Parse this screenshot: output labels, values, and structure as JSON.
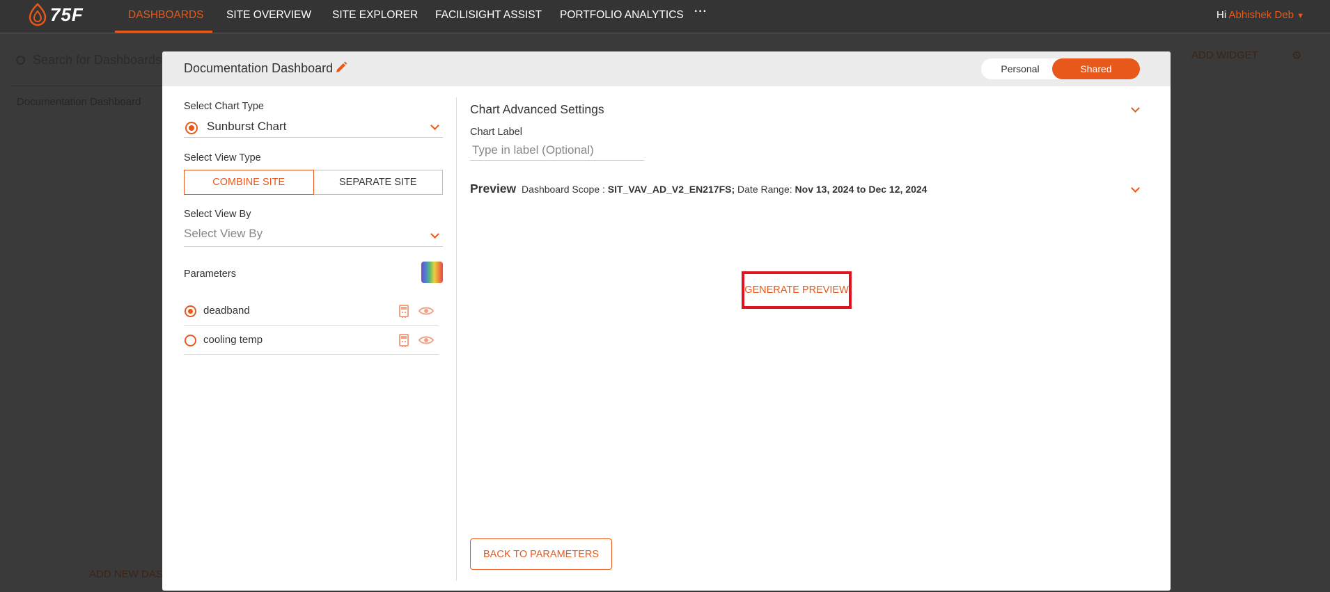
{
  "brand": {
    "logo_text": "75F",
    "accent_color": "#e8581a",
    "highlight_color": "#e0141e"
  },
  "nav": {
    "items": [
      {
        "label": "DASHBOARDS",
        "active": true
      },
      {
        "label": "SITE OVERVIEW",
        "active": false
      },
      {
        "label": "SITE EXPLORER",
        "active": false
      },
      {
        "label": "FACILISIGHT ASSIST",
        "active": false
      },
      {
        "label": "PORTFOLIO ANALYTICS",
        "active": false
      }
    ],
    "more_label": "···",
    "greeting": "Hi",
    "user_name": "Abhishek Deb"
  },
  "background": {
    "search_placeholder": "Search for Dashboards",
    "dashboard_list_item": "Documentation Dashboard",
    "add_widget_label": "ADD WIDGET",
    "add_new_label": "ADD NEW DAS"
  },
  "modal": {
    "title": "Documentation Dashboard",
    "toggle": {
      "personal": "Personal",
      "shared": "Shared",
      "selected": "Shared"
    },
    "left": {
      "chart_type_label": "Select Chart Type",
      "chart_type_value": "Sunburst Chart",
      "view_type_label": "Select View Type",
      "view_type_options": [
        "COMBINE SITE",
        "SEPARATE SITE"
      ],
      "view_type_selected": "COMBINE SITE",
      "view_by_label": "Select View By",
      "view_by_placeholder": "Select View By",
      "parameters_label": "Parameters",
      "parameters": [
        {
          "name": "deadband",
          "selected": true
        },
        {
          "name": "cooling temp",
          "selected": false
        }
      ]
    },
    "right": {
      "advanced_settings_title": "Chart Advanced Settings",
      "chart_label_caption": "Chart Label",
      "chart_label_placeholder": "Type in label (Optional)",
      "preview_title": "Preview",
      "scope_label": "Dashboard Scope :",
      "scope_value": "SIT_VAV_AD_V2_EN217FS;",
      "date_range_label": "Date Range:",
      "date_range_value": "Nov 13, 2024 to Dec 12, 2024",
      "generate_preview_label": "GENERATE PREVIEW",
      "back_label": "BACK TO PARAMETERS"
    }
  }
}
